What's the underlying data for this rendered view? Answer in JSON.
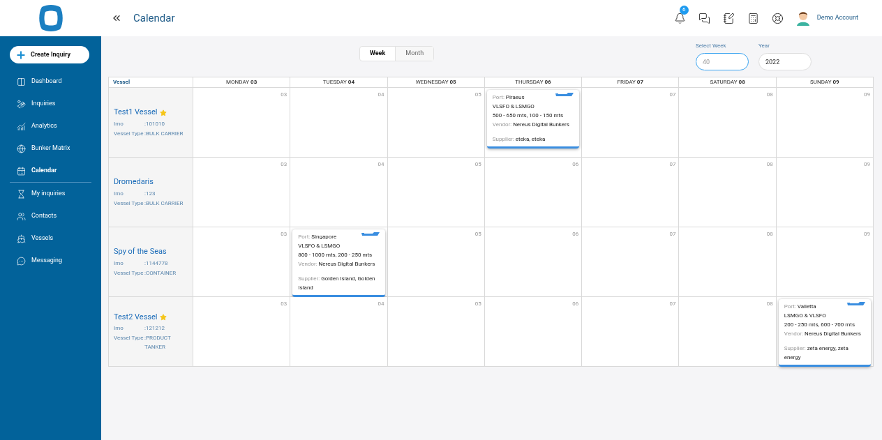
{
  "header": {
    "title": "Calendar",
    "notifications": "6",
    "account": "Demo Account"
  },
  "sidebar": {
    "create_button": "Create Inquiry",
    "items": [
      {
        "label": "Dashboard",
        "selected": false
      },
      {
        "label": "Inquiries",
        "selected": false
      },
      {
        "label": "Analytics",
        "selected": false
      },
      {
        "label": "Bunker Matrix",
        "selected": false
      },
      {
        "label": "Calendar",
        "selected": true
      },
      {
        "label": "My inquiries",
        "selected": false
      },
      {
        "label": "Contacts",
        "selected": false
      },
      {
        "label": "Vessels",
        "selected": false
      },
      {
        "label": "Messaging",
        "selected": false
      }
    ]
  },
  "view_toggle": [
    {
      "label": "Week",
      "selected": true
    },
    {
      "label": "Month",
      "selected": false
    }
  ],
  "week_field": {
    "label": "Select Week",
    "placeholder": "40"
  },
  "year_field": {
    "label": "Year",
    "value": "2022"
  },
  "calendar": {
    "vessel_header": "Vessel",
    "days": [
      {
        "label": "MONDAY **03**"
      },
      {
        "label": "TUESDAY **04**"
      },
      {
        "label": "WEDNESDAY **05**"
      },
      {
        "label": "THURSDAY **06**"
      },
      {
        "label": "FRIDAY **07**"
      },
      {
        "label": "SATURDAY **08**"
      },
      {
        "label": "SUNDAY **09**"
      }
    ],
    "rows": [
      {
        "vessel": {
          "name": "Test1 Vessel",
          "starred": true,
          "fields": [
            {
              "label": "Imo",
              "value": ":101010"
            },
            {
              "label": "Vessel Type",
              "value": ":BULK CARRIER"
            }
          ]
        },
        "cells": [
          {
            "date": "03"
          },
          {
            "date": "04"
          },
          {
            "date": "05"
          },
          {
            "booking": {
              "port_label": "Port:",
              "port": "Piraeus",
              "fuels": "VLSFO & LSMGO",
              "quantities": "500 - 650 mts, 100 - 150 mts",
              "vendor_label": "Vendor:",
              "vendor": "Nereus Digital Bunkers",
              "supplier_label": "Supplier:",
              "supplier": "eteka, eteka"
            }
          },
          {
            "date": "07"
          },
          {
            "date": "08"
          },
          {
            "date": "09"
          }
        ]
      },
      {
        "vessel": {
          "name": "Dromedaris",
          "starred": false,
          "fields": [
            {
              "label": "Imo",
              "value": ":123"
            },
            {
              "label": "Vessel Type",
              "value": ":BULK CARRIER"
            }
          ]
        },
        "cells": [
          {
            "date": "03"
          },
          {
            "date": "04"
          },
          {
            "date": "05"
          },
          {
            "date": "06"
          },
          {
            "date": "07"
          },
          {
            "date": "08"
          },
          {
            "date": "09"
          }
        ]
      },
      {
        "vessel": {
          "name": "Spy of the Seas",
          "starred": false,
          "fields": [
            {
              "label": "Imo",
              "value": ":1144778"
            },
            {
              "label": "Vessel Type",
              "value": ":CONTAINER"
            }
          ]
        },
        "cells": [
          {
            "date": "03"
          },
          {
            "booking": {
              "port_label": "Port:",
              "port": "Singapore",
              "fuels": "VLSFO & LSMGO",
              "quantities": "800 - 1000 mts, 200 - 250 mts",
              "vendor_label": "Vendor:",
              "vendor": "Nereus Digital Bunkers",
              "supplier_label": "Supplier:",
              "supplier": "Golden Island, Golden Island"
            }
          },
          {
            "date": "05"
          },
          {
            "date": "06"
          },
          {
            "date": "07"
          },
          {
            "date": "08"
          },
          {
            "date": "09"
          }
        ]
      },
      {
        "vessel": {
          "name": "Test2 Vessel",
          "starred": true,
          "fields": [
            {
              "label": "Imo",
              "value": ":121212"
            },
            {
              "label": "Vessel Type",
              "value": ":PRODUCT TANKER"
            }
          ]
        },
        "cells": [
          {
            "date": "03"
          },
          {
            "date": "04"
          },
          {
            "date": "05"
          },
          {
            "date": "06"
          },
          {
            "date": "07"
          },
          {
            "date": "08"
          },
          {
            "booking": {
              "port_label": "Port:",
              "port": "Valletta",
              "fuels": "LSMGO & VLSFO",
              "quantities": "200 - 250 mts, 600 - 700 mts",
              "vendor_label": "Vendor:",
              "vendor": "Nereus Digital Bunkers",
              "supplier_label": "Supplier:",
              "supplier": "zeta energy, zeta energy"
            }
          }
        ]
      }
    ]
  }
}
